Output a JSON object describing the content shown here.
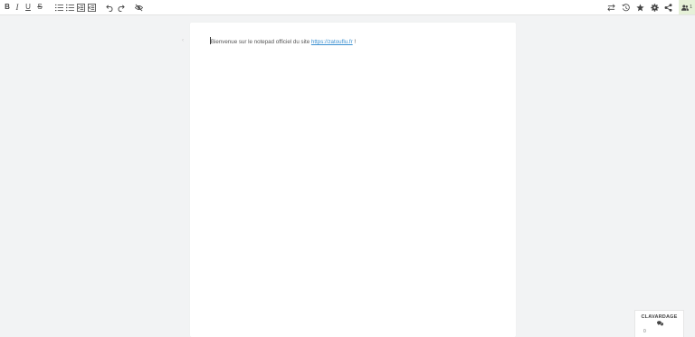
{
  "toolbar": {
    "bold": "B",
    "italic": "I",
    "underline": "U",
    "strike": "S",
    "users_count": "1"
  },
  "document": {
    "gutter_mark": "‹",
    "text_before": "Bienvenue sur le notepad officiel du site ",
    "link_text": "https://zatouflu.fr",
    "text_after": " !"
  },
  "chat": {
    "title": "CLAVARDAGE",
    "count": "0"
  },
  "icons": [
    "bold-icon",
    "italic-icon",
    "underline-icon",
    "strikethrough-icon",
    "ordered-list-icon",
    "unordered-list-icon",
    "indent-icon",
    "outdent-icon",
    "undo-icon",
    "redo-icon",
    "hide-icon",
    "import-export-icon",
    "history-icon",
    "star-icon",
    "gear-icon",
    "share-icon",
    "users-icon",
    "chat-bubbles-icon"
  ],
  "colors": {
    "accent_link": "#3a8fd0",
    "users_bg": "#e6f1d8",
    "background": "#f2f3f4"
  }
}
